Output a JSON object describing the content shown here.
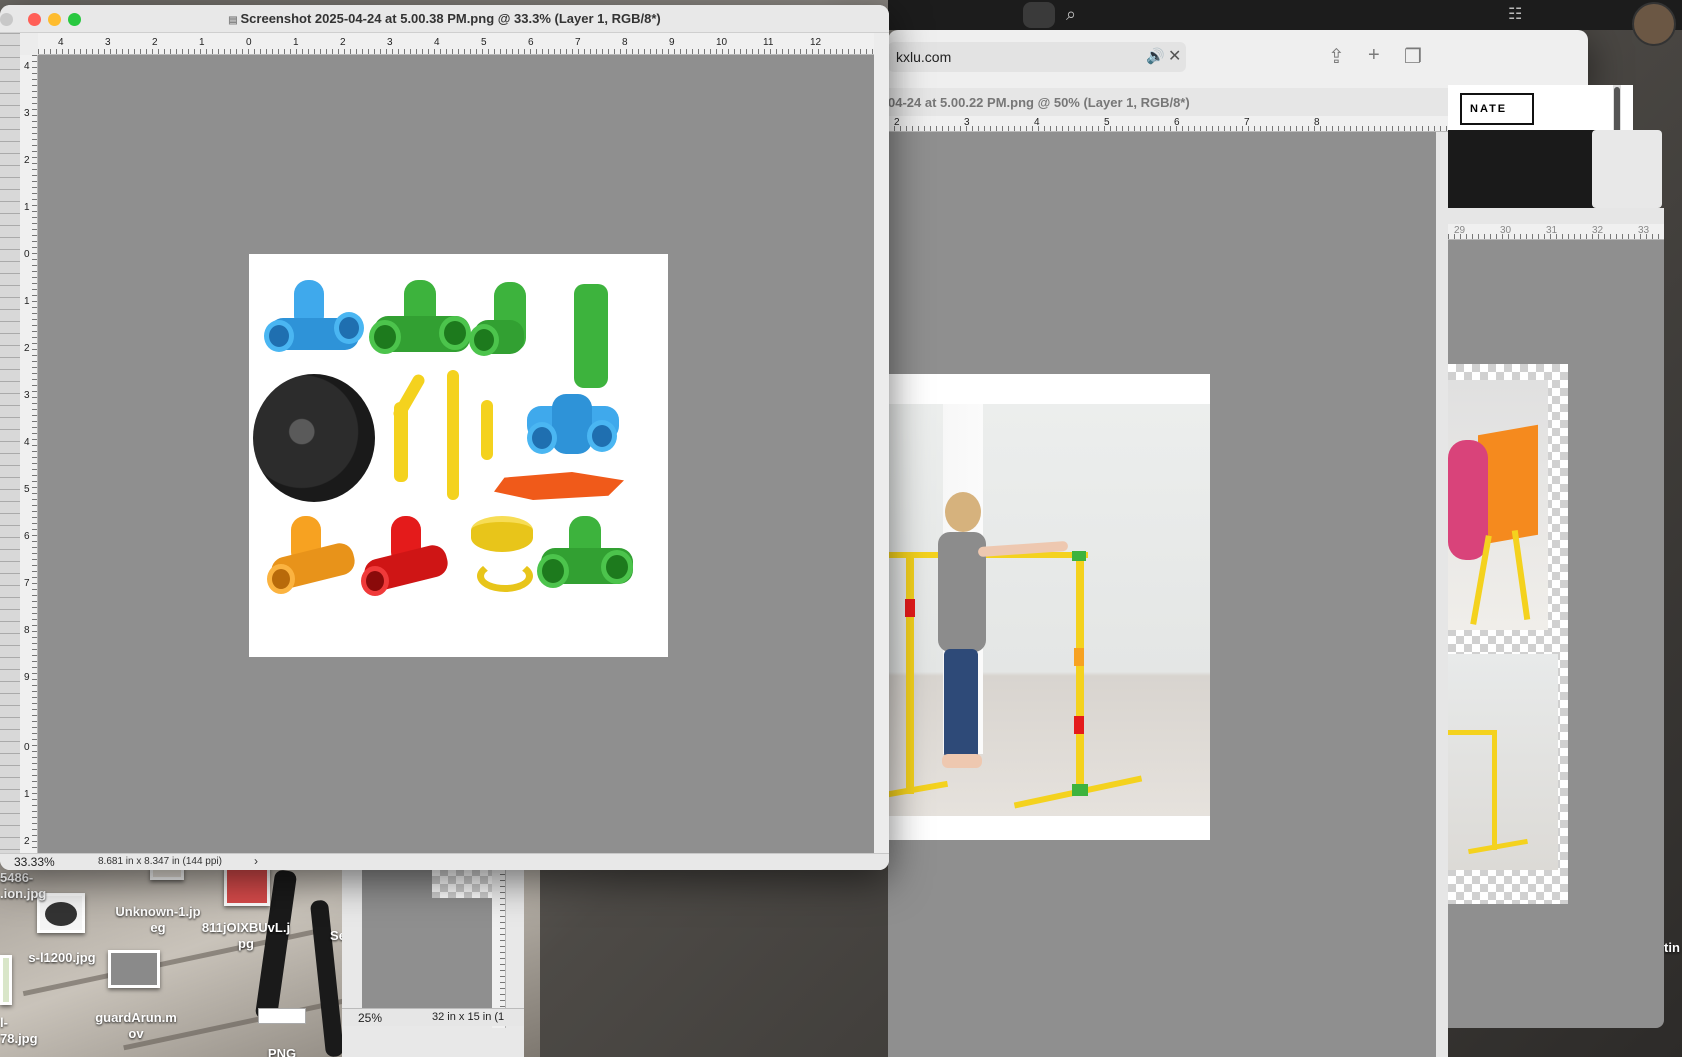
{
  "main_window": {
    "title": "Screenshot 2025-04-24 at 5.00.38 PM.png @ 33.3% (Layer 1, RGB/8*)",
    "zoom": "33.33%",
    "doc_info": "8.681 in x 8.347 in (144 ppi)",
    "h_ruler": [
      "4",
      "3",
      "2",
      "1",
      "0",
      "1",
      "2",
      "3",
      "4",
      "5",
      "6",
      "7",
      "8",
      "9",
      "10",
      "11",
      "12"
    ],
    "v_ruler": [
      "4",
      "3",
      "2",
      "1",
      "0",
      "1",
      "2",
      "3",
      "4",
      "5",
      "6",
      "7",
      "8",
      "9",
      "0",
      "1",
      "2"
    ]
  },
  "browser": {
    "address": "kxlu.com",
    "donate_label": "NATE"
  },
  "second_window": {
    "title": "04-24 at 5.00.22 PM.png @ 50% (Layer 1, RGB/8*)",
    "h_ruler": [
      "2",
      "3",
      "4",
      "5",
      "6",
      "7",
      "8"
    ]
  },
  "third_window": {
    "h_ruler": [
      "29",
      "30",
      "31",
      "32",
      "33"
    ]
  },
  "small_window": {
    "zoom": "25%",
    "doc_info": "32 in x 15 in (1"
  },
  "desktop_files": [
    {
      "label": "5486-\n.ion.jpg"
    },
    {
      "label": "Unknown-1.jp\neg"
    },
    {
      "label": "811jOIXBUvL.j\npg"
    },
    {
      "label": "Se"
    },
    {
      "label": "s-l1200.jpg"
    },
    {
      "label": "guardArun.m\nov"
    },
    {
      "label": "l-\n78.jpg"
    },
    {
      "label": "PNG"
    },
    {
      "label": "tin"
    }
  ],
  "colors": {
    "blue": "#3fa9ec",
    "green": "#3db33d",
    "yellow": "#f4d21e",
    "orange": "#f7a221",
    "red": "#e41b1b",
    "wheel": "#2c2c2c",
    "plate": "#f05a1a"
  }
}
